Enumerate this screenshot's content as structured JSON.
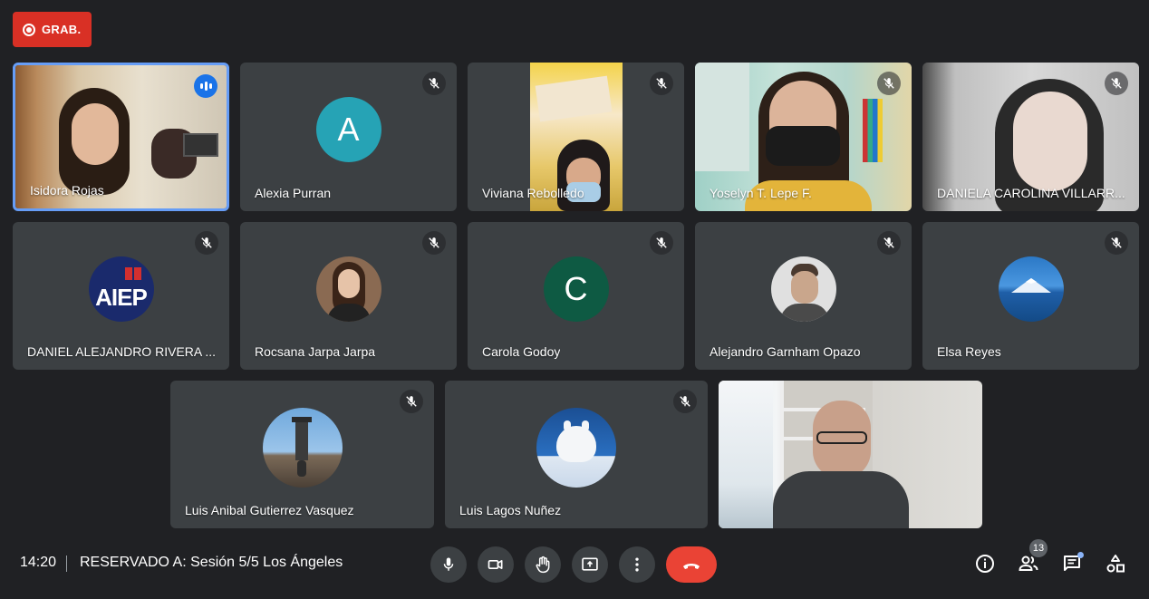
{
  "recording": {
    "label": "GRAB."
  },
  "participants": [
    {
      "name": "Isidora Rojas",
      "type": "video",
      "speaking": true
    },
    {
      "name": "Alexia Purran",
      "type": "avatar",
      "initial": "A",
      "avatar_color": "#26a3b5"
    },
    {
      "name": "Viviana Rebolledo",
      "type": "video"
    },
    {
      "name": "Yoselyn T. Lepe F.",
      "type": "video"
    },
    {
      "name": "DANIELA CAROLINA VILLARR...",
      "type": "video"
    },
    {
      "name": "DANIEL ALEJANDRO RIVERA ...",
      "type": "avatar-photo",
      "logo_text": "AIEP"
    },
    {
      "name": "Rocsana Jarpa Jarpa",
      "type": "avatar-photo"
    },
    {
      "name": "Carola Godoy",
      "type": "avatar",
      "initial": "C",
      "avatar_color": "#0e5a43"
    },
    {
      "name": "Alejandro Garnham Opazo",
      "type": "avatar-photo"
    },
    {
      "name": "Elsa Reyes",
      "type": "avatar-photo"
    },
    {
      "name": "Luis Anibal Gutierrez Vasquez",
      "type": "avatar-photo"
    },
    {
      "name": "Luis Lagos Nuñez",
      "type": "avatar-photo"
    },
    {
      "name": "",
      "type": "video"
    }
  ],
  "footer": {
    "time": "14:20",
    "meeting_title": "RESERVADO A: Sesión 5/5 Los Ángeles",
    "people_count": "13"
  },
  "colors": {
    "background": "#202124",
    "tile": "#3c4043",
    "hangup": "#ea4335",
    "record": "#d93025",
    "active_border": "#669df6"
  }
}
